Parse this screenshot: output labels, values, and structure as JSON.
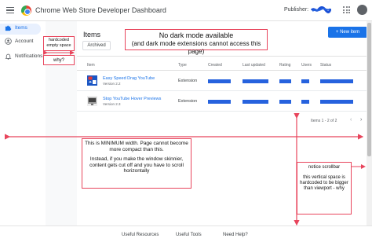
{
  "app": {
    "title": "Chrome Web Store Developer Dashboard",
    "publisher_label": "Publisher:"
  },
  "sidebar": {
    "items": [
      {
        "label": "Items",
        "icon": "extension-icon",
        "active": true
      },
      {
        "label": "Account",
        "icon": "account-circle-icon",
        "active": false
      },
      {
        "label": "Notifications",
        "icon": "bell-icon",
        "active": false
      }
    ]
  },
  "main": {
    "heading": "Items",
    "tab_archived": "Archived",
    "new_item_button": "+ New item",
    "columns": [
      "Item",
      "Type",
      "Created",
      "Last updated",
      "Rating",
      "Users",
      "Status"
    ],
    "rows": [
      {
        "name": "Easy Speed Drag YouTube",
        "version": "Version 2.2",
        "type": "Extension"
      },
      {
        "name": "Stop YouTube Hover Previews",
        "version": "Version 2.3",
        "type": "Extension"
      }
    ],
    "pagination": "Items 1 - 2 of 2"
  },
  "footer": {
    "links": [
      "Useful Resources",
      "Useful Tools",
      "Need Help?"
    ]
  },
  "annotations": {
    "hardcoded": "hardcoded empty space",
    "why": "why?",
    "dark_mode_title": "No dark mode available",
    "dark_mode_sub": "(and dark mode extensions cannot access this page)",
    "min_width_1": "This is MINIMUM width. Page cannot become more compact than this.",
    "min_width_2": "Instead, if you make the window skinnier, content gets cut off and you have to scroll horizontally",
    "scrollbar_1": "notice scrollbar",
    "scrollbar_2": "this vertical space is hardcoded to be bigger than viewport - why"
  },
  "colors": {
    "accent": "#1a73e8",
    "redacted_bar": "#2662de",
    "annotation": "#e8455c"
  }
}
